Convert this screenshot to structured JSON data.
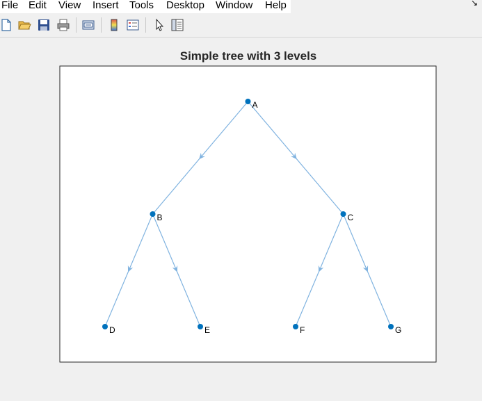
{
  "menu": {
    "items": [
      "File",
      "Edit",
      "View",
      "Insert",
      "Tools",
      "Desktop",
      "Window",
      "Help"
    ]
  },
  "toolbar": {
    "buttons": [
      {
        "name": "new-figure-icon"
      },
      {
        "name": "open-file-icon"
      },
      {
        "name": "save-icon"
      },
      {
        "name": "print-icon"
      },
      {
        "name": "link-plot-icon"
      },
      {
        "name": "insert-colorbar-icon"
      },
      {
        "name": "insert-legend-icon"
      },
      {
        "name": "edit-plot-icon"
      },
      {
        "name": "property-inspector-icon"
      }
    ]
  },
  "figure": {
    "title": "Simple tree with 3 levels"
  },
  "chart_data": {
    "type": "graph",
    "title": "Simple tree with 3 levels",
    "node_color": "#0072bd",
    "edge_color": "#80b3e0",
    "directed": true,
    "nodes": [
      {
        "id": "A",
        "level": 1
      },
      {
        "id": "B",
        "level": 2
      },
      {
        "id": "C",
        "level": 2
      },
      {
        "id": "D",
        "level": 3
      },
      {
        "id": "E",
        "level": 3
      },
      {
        "id": "F",
        "level": 3
      },
      {
        "id": "G",
        "level": 3
      }
    ],
    "edges": [
      [
        "A",
        "B"
      ],
      [
        "A",
        "C"
      ],
      [
        "B",
        "D"
      ],
      [
        "B",
        "E"
      ],
      [
        "C",
        "F"
      ],
      [
        "C",
        "G"
      ]
    ]
  }
}
